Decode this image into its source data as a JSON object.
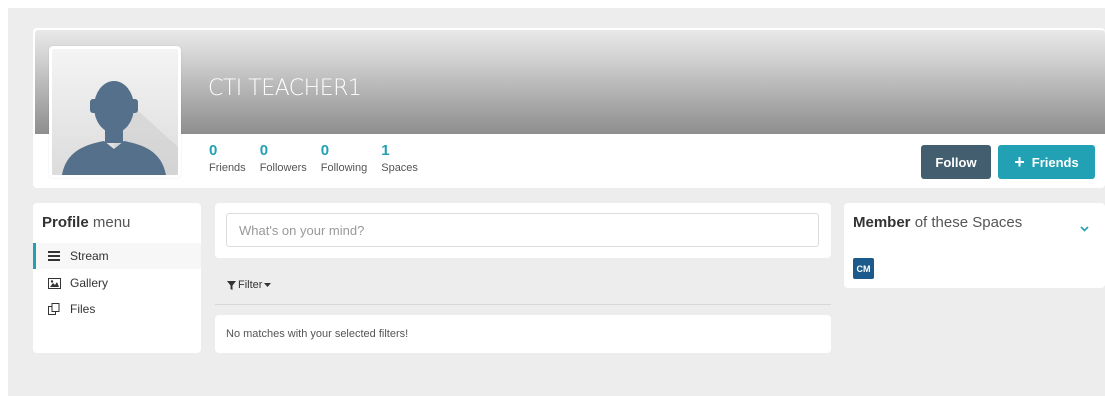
{
  "profile": {
    "name": "CTI TEACHER1",
    "stats": [
      {
        "count": "0",
        "label": "Friends"
      },
      {
        "count": "0",
        "label": "Followers"
      },
      {
        "count": "0",
        "label": "Following"
      },
      {
        "count": "1",
        "label": "Spaces"
      }
    ],
    "follow_label": "Follow",
    "friends_label": "Friends"
  },
  "menu": {
    "title_bold": "Profile",
    "title_rest": " menu",
    "items": [
      {
        "label": "Stream",
        "icon": "bars-icon",
        "active": true
      },
      {
        "label": "Gallery",
        "icon": "image-icon",
        "active": false
      },
      {
        "label": "Files",
        "icon": "files-icon",
        "active": false
      }
    ]
  },
  "stream": {
    "placeholder": "What's on your mind?",
    "filter_label": "Filter",
    "empty_message": "No matches with your selected filters!"
  },
  "spaces": {
    "title_bold": "Member",
    "title_rest": " of these Spaces",
    "items": [
      {
        "abbr": "CM"
      }
    ]
  },
  "colors": {
    "accent": "#21a1b3",
    "follow_button": "#435f6f",
    "space_badge": "#1b5a8a",
    "background": "#ededed"
  }
}
